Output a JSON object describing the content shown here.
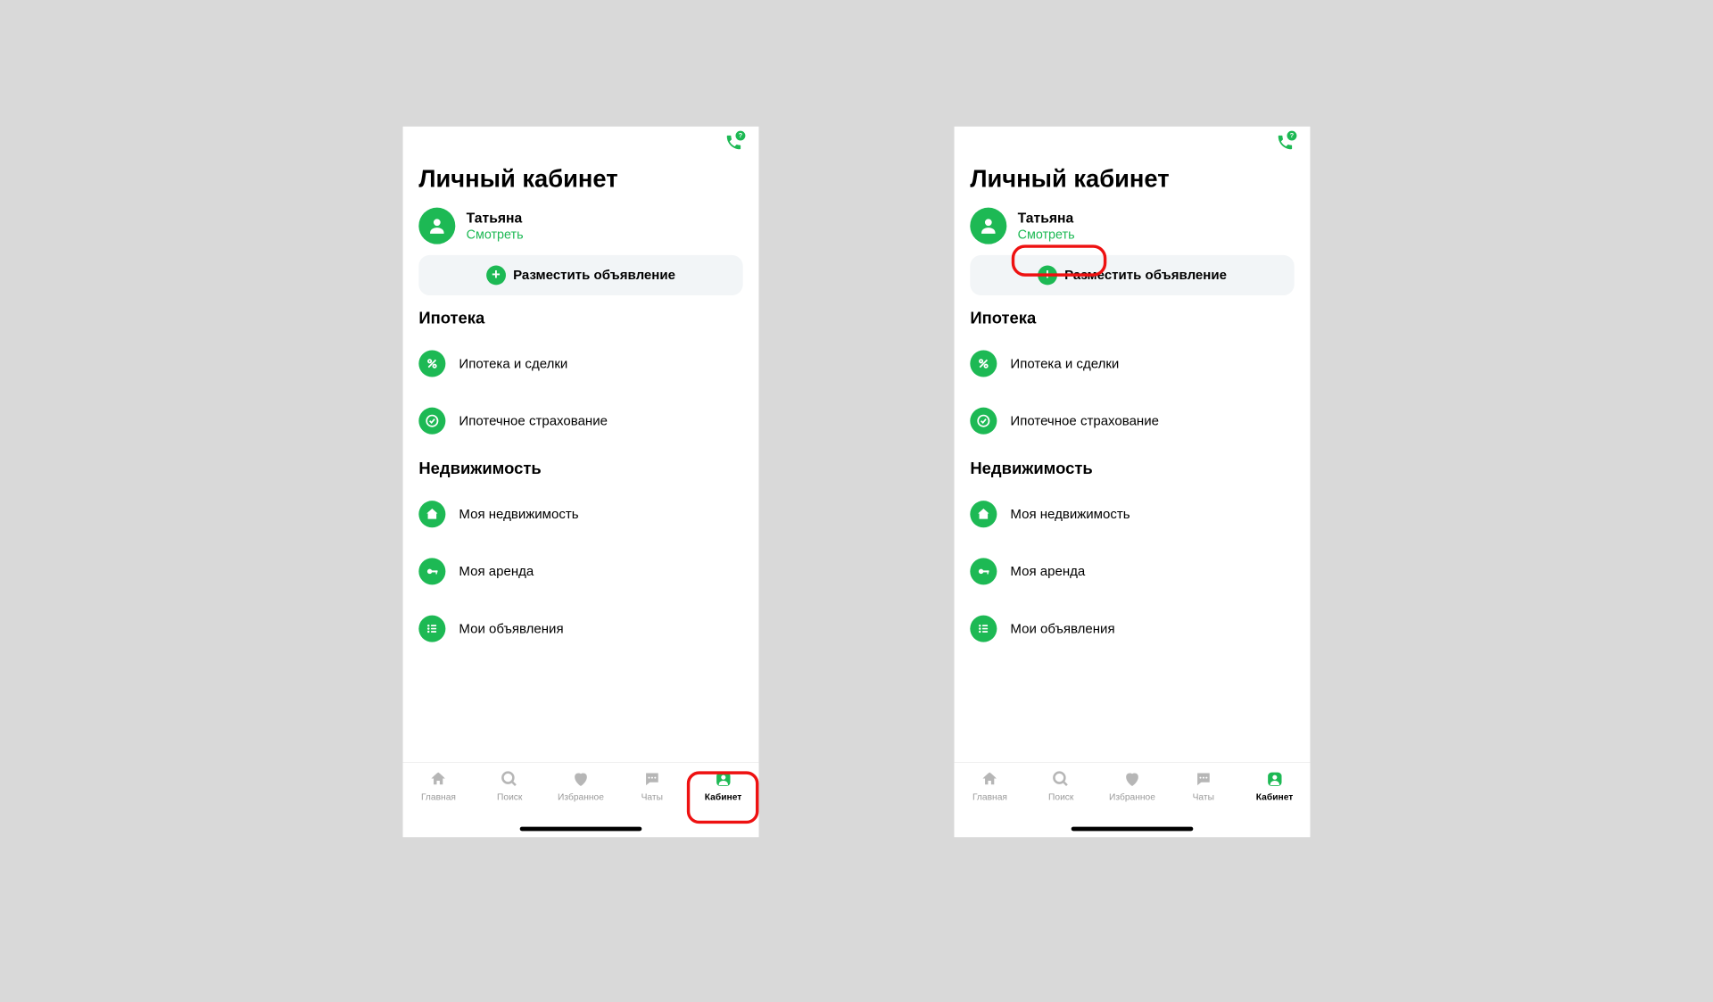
{
  "colors": {
    "accent": "#1db954",
    "annot": "#e11"
  },
  "screens": [
    {
      "title": "Личный кабинет",
      "profile": {
        "name": "Татьяна",
        "view_label": "Смотреть"
      },
      "post_button": "Разместить объявление",
      "sections": [
        {
          "heading": "Ипотека",
          "items": [
            {
              "icon": "percent-icon",
              "label": "Ипотека и сделки"
            },
            {
              "icon": "check-icon",
              "label": "Ипотечное страхование"
            }
          ]
        },
        {
          "heading": "Недвижимость",
          "items": [
            {
              "icon": "house-icon",
              "label": "Моя недвижимость"
            },
            {
              "icon": "key-icon",
              "label": "Моя аренда"
            },
            {
              "icon": "list-icon",
              "label": "Мои объявления"
            }
          ]
        }
      ],
      "nav": [
        {
          "icon": "home-icon",
          "label": "Главная",
          "active": false
        },
        {
          "icon": "search-icon",
          "label": "Поиск",
          "active": false
        },
        {
          "icon": "heart-icon",
          "label": "Избранное",
          "active": false
        },
        {
          "icon": "chat-icon",
          "label": "Чаты",
          "active": false
        },
        {
          "icon": "person-icon",
          "label": "Кабинет",
          "active": true
        }
      ],
      "annotation": {
        "target": "nav-cabinet"
      }
    },
    {
      "title": "Личный кабинет",
      "profile": {
        "name": "Татьяна",
        "view_label": "Смотреть"
      },
      "post_button": "Разместить объявление",
      "sections": [
        {
          "heading": "Ипотека",
          "items": [
            {
              "icon": "percent-icon",
              "label": "Ипотека и сделки"
            },
            {
              "icon": "check-icon",
              "label": "Ипотечное страхование"
            }
          ]
        },
        {
          "heading": "Недвижимость",
          "items": [
            {
              "icon": "house-icon",
              "label": "Моя недвижимость"
            },
            {
              "icon": "key-icon",
              "label": "Моя аренда"
            },
            {
              "icon": "list-icon",
              "label": "Мои объявления"
            }
          ]
        }
      ],
      "nav": [
        {
          "icon": "home-icon",
          "label": "Главная",
          "active": false
        },
        {
          "icon": "search-icon",
          "label": "Поиск",
          "active": false
        },
        {
          "icon": "heart-icon",
          "label": "Избранное",
          "active": false
        },
        {
          "icon": "chat-icon",
          "label": "Чаты",
          "active": false
        },
        {
          "icon": "person-icon",
          "label": "Кабинет",
          "active": true
        }
      ],
      "annotation": {
        "target": "profile-view"
      }
    }
  ]
}
